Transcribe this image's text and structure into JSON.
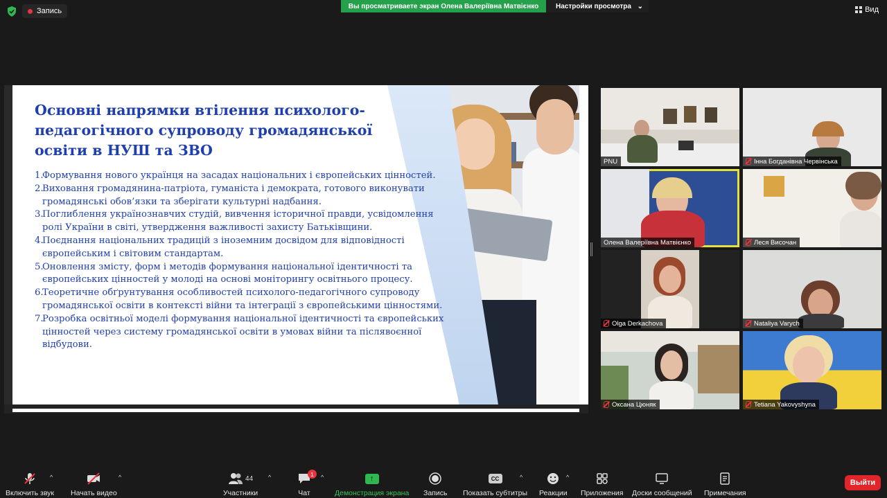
{
  "top": {
    "recording_label": "Запись",
    "share_banner": "Вы просматриваете экран Олена Валеріївна Матвієнко",
    "view_settings": "Настройки просмотра",
    "view_label": "Вид"
  },
  "slide": {
    "title": "Основні напрямки втілення психолого-педагогічного супроводу громадянської освіти в НУШ та ЗВО",
    "items": [
      {
        "num": "1.",
        "text": "Формування нового українця на засадах національних і європейських цінностей."
      },
      {
        "num": "2.",
        "text": "Виховання громадянина-патріота, гуманіста і демократа, готового виконувати громадянські обов’язки та зберігати культурні надбання."
      },
      {
        "num": "3.",
        "text": "Поглиблення українознавчих студій, вивчення історичної правди, усвідомлення ролі України в світі, утвердження важливості захисту Батьківщини."
      },
      {
        "num": "4.",
        "text": "Поєднання національних традицій з іноземним досвідом для відповідності європейським і світовим стандартам."
      },
      {
        "num": "5.",
        "text": "Оновлення змісту, форм і методів формування національної ідентичності та європейських цінностей у молоді на основі моніторингу освітнього процесу."
      },
      {
        "num": "6.",
        "text": "Теоретичне обґрунтування особливостей психолого-педагогічного супроводу громадянської освіти в контексті війни та інтеграції з європейськими цінностями."
      },
      {
        "num": "7.",
        "text": "Розробка освітньої моделі формування національної ідентичності та європейських цінностей через систему громадянської освіти в умовах війни та післявоєнної відбудови."
      }
    ]
  },
  "participants": [
    {
      "name": "PNU",
      "muted": false,
      "active": false
    },
    {
      "name": "Інна Богданівна Червінська",
      "muted": true,
      "active": false
    },
    {
      "name": "Олена Валеріївна Матвієнко",
      "muted": false,
      "active": true
    },
    {
      "name": "Леся Височан",
      "muted": true,
      "active": false
    },
    {
      "name": "Olga Derkachova",
      "muted": true,
      "active": false
    },
    {
      "name": "Nataliya Varych",
      "muted": true,
      "active": false
    },
    {
      "name": "Оксана Цюняк",
      "muted": true,
      "active": false
    },
    {
      "name": "Tetiana Yakovyshyna",
      "muted": true,
      "active": false
    }
  ],
  "toolbar": {
    "mute_audio": "Включить звук",
    "start_video": "Начать видео",
    "participants": "Участники",
    "participants_count": "44",
    "chat": "Чат",
    "chat_badge": "1",
    "share_screen": "Демонстрация экрана",
    "record": "Запись",
    "captions": "Показать субтитры",
    "captions_icon_text": "CC",
    "reactions": "Реакции",
    "apps": "Приложения",
    "whiteboards": "Доски сообщений",
    "notes": "Примечания",
    "leave": "Выйти"
  },
  "colors": {
    "share_banner": "#26a14b",
    "slide_text": "#1f3fae",
    "active_speaker": "#e4e13a",
    "leave": "#e0252b"
  }
}
